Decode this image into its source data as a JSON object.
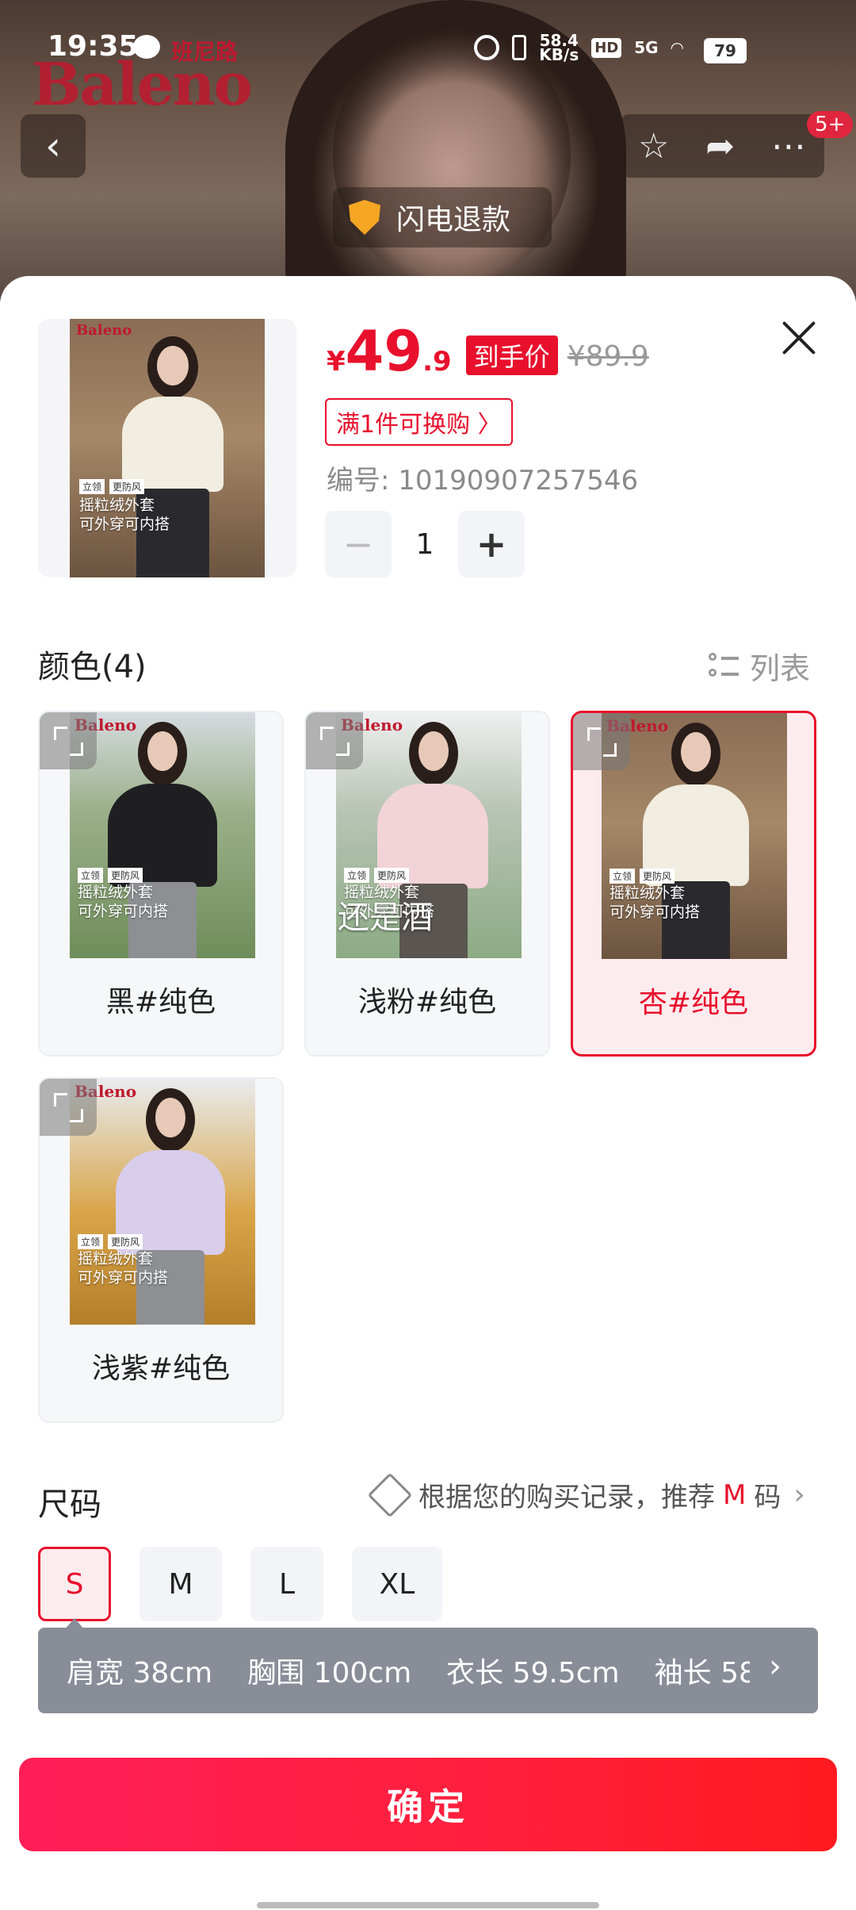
{
  "status_bar": {
    "time": "19:35",
    "net_speed_top": "58.4",
    "net_speed_bottom": "KB/s",
    "hd": "HD",
    "signal": "5G",
    "battery": "79"
  },
  "hero": {
    "brand_cn": "班尼路",
    "brand_en": "Baleno",
    "refund_label": "闪电退款",
    "cart_badge": "5+"
  },
  "product": {
    "currency": "¥",
    "price_int": "49",
    "price_dec": ".9",
    "price_tag": "到手价",
    "original_price": "¥89.9",
    "promo": "满1件可换购 〉",
    "sku_label": "编号: 10190907257546",
    "quantity": "1",
    "thumb_tagline_1": "摇粒绒外套",
    "thumb_tagline_2": "可外穿可内搭",
    "thumb_chip_1": "立领",
    "thumb_chip_2": "更防风"
  },
  "color_section": {
    "title": "颜色(4)",
    "list_toggle": "列表",
    "options": [
      {
        "label": "黑#纯色",
        "selected": false,
        "jacket": "#1f1f22",
        "bg": "#7e9b6a"
      },
      {
        "label": "浅粉#纯色",
        "selected": false,
        "jacket": "#f1d3d8",
        "bg": "#8cab84",
        "overlay": "还是酒"
      },
      {
        "label": "杏#纯色",
        "selected": true,
        "jacket": "#f1ede0",
        "bg": "#8a6d55"
      },
      {
        "label": "浅紫#纯色",
        "selected": false,
        "jacket": "#d8cdeb",
        "bg": "#d9a447"
      }
    ]
  },
  "size_section": {
    "title": "尺码",
    "reco_prefix": "根据您的购买记录，推荐",
    "reco_size": "M",
    "reco_suffix": "码",
    "sizes": [
      "S",
      "M",
      "L",
      "XL"
    ],
    "selected": "S",
    "measurements": [
      "肩宽 38cm",
      "胸围 100cm",
      "衣长 59.5cm",
      "袖长 58"
    ]
  },
  "confirm_label": "确定",
  "colors": {
    "accent": "#e8102c",
    "confirm_gradient_start": "#ff1e57",
    "confirm_gradient_end": "#ff1a20"
  }
}
